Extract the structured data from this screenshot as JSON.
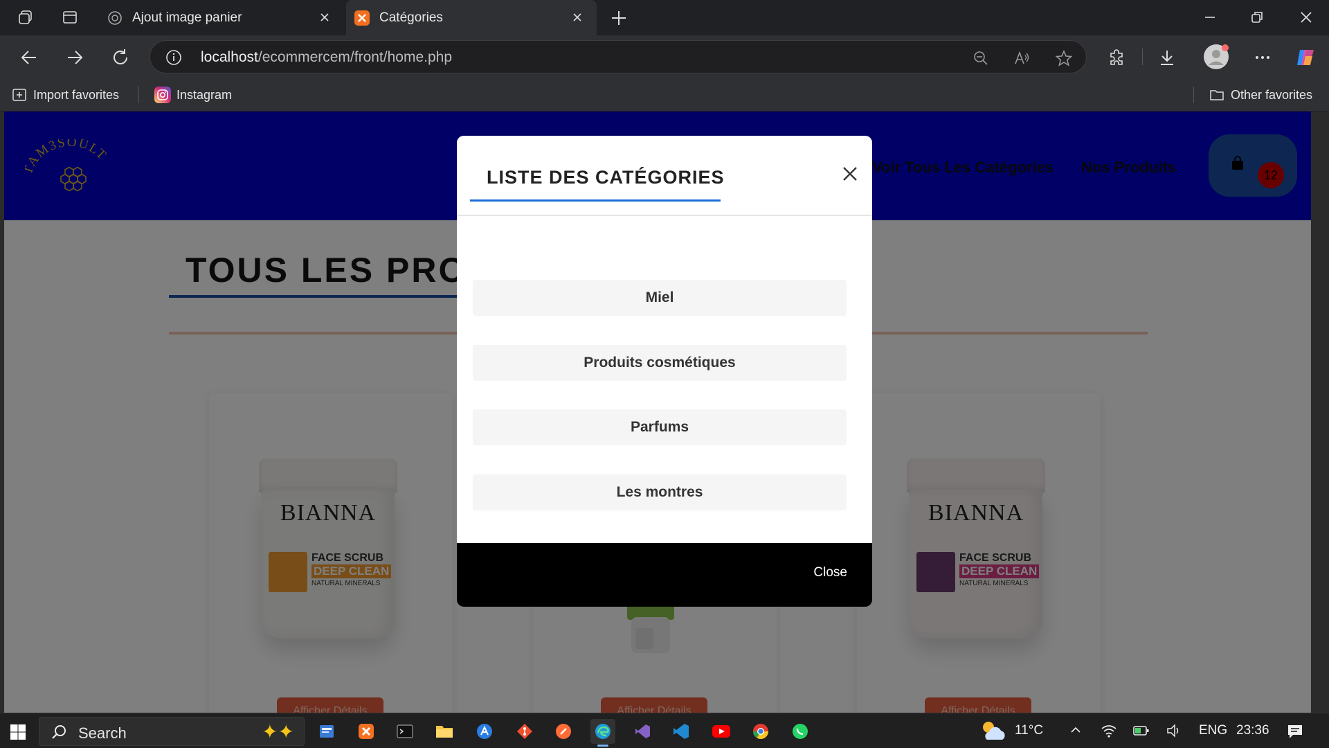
{
  "browser": {
    "tabs": [
      {
        "label": "Ajout image panier"
      },
      {
        "label": "Catégories"
      }
    ],
    "address": {
      "host": "localhost",
      "path": "/ecommercem/front/home.php"
    },
    "favorites": {
      "import_label": "Import favorites",
      "instagram_label": "Instagram",
      "other_label": "Other favorites"
    }
  },
  "site": {
    "logo_text": "TAM3SOULT",
    "nav": {
      "categories_label": "Voir Tous Les Catégories",
      "products_label": "Nos Produits"
    },
    "cart_count": "12",
    "section_title": "TOUS LES PRODUITS",
    "products": [
      {
        "brand": "BIANNA",
        "line1": "FACE SCRUB",
        "line2": "DEEP CLEAN",
        "line3": "NATURAL MINERALS",
        "button": "Afficher Détails",
        "accent": "#f29a2e"
      },
      {
        "brand": "",
        "line1": "",
        "line2": "",
        "line3": "",
        "button": "Afficher Détails",
        "accent": "#8bc34a"
      },
      {
        "brand": "BIANNA",
        "line1": "FACE SCRUB",
        "line2": "DEEP CLEAN",
        "line3": "NATURAL MINERALS",
        "button": "Afficher Détails",
        "accent": "#d63d84"
      }
    ]
  },
  "modal": {
    "title": "LISTE DES CATÉGORIES",
    "categories": [
      "Miel",
      "Produits cosmétiques",
      "Parfums",
      "Les montres"
    ],
    "close_label": "Close"
  },
  "taskbar": {
    "search_placeholder": "Search",
    "weather": "11°C",
    "language": "ENG",
    "time": "23:36"
  },
  "colors": {
    "header_bg": "#0000cc",
    "cart_bg": "#1a4fa5",
    "accent_blue": "#1a6fd6",
    "detail_button": "#e55e3e",
    "modal_footer": "#000000"
  }
}
